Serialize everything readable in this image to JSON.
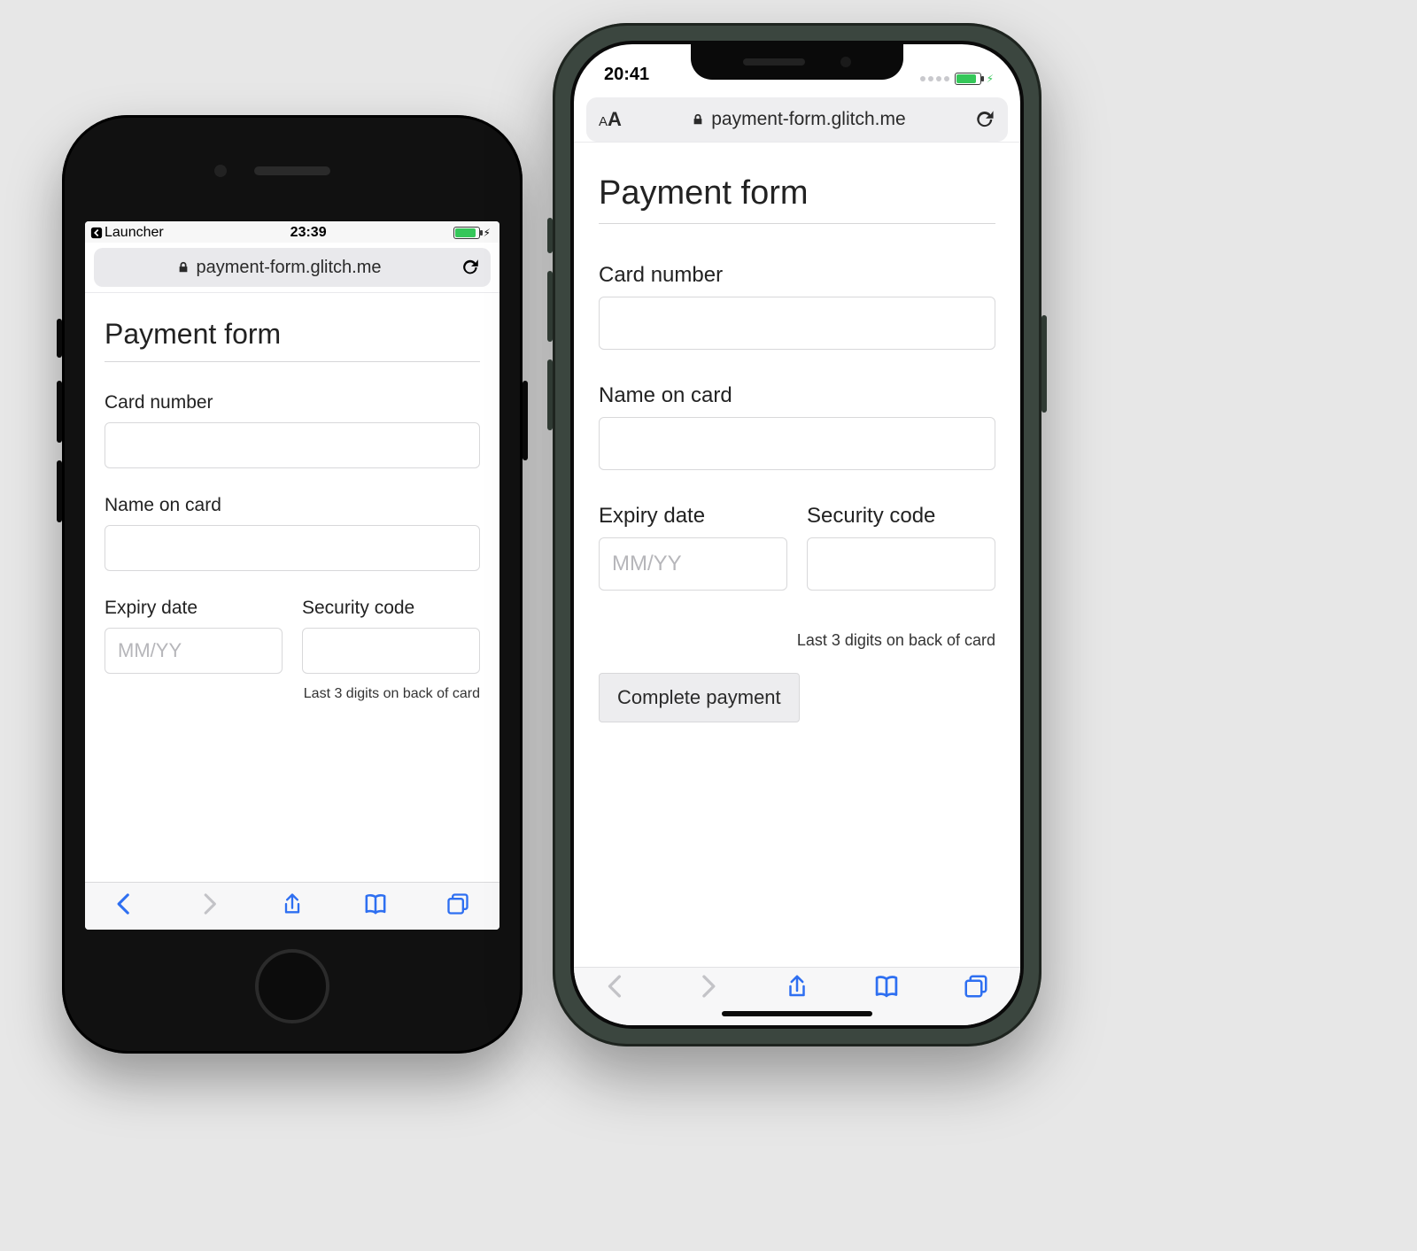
{
  "left": {
    "status": {
      "back_app": "Launcher",
      "time": "23:39"
    },
    "address_bar": {
      "url": "payment-form.glitch.me"
    },
    "page": {
      "title": "Payment form",
      "card_number_label": "Card number",
      "name_label": "Name on card",
      "expiry_label": "Expiry date",
      "expiry_placeholder": "MM/YY",
      "cvc_label": "Security code",
      "cvc_hint": "Last 3 digits on back of card"
    }
  },
  "right": {
    "status": {
      "time": "20:41"
    },
    "address_bar": {
      "aa_small": "A",
      "aa_large": "A",
      "url": "payment-form.glitch.me"
    },
    "page": {
      "title": "Payment form",
      "card_number_label": "Card number",
      "name_label": "Name on card",
      "expiry_label": "Expiry date",
      "expiry_placeholder": "MM/YY",
      "cvc_label": "Security code",
      "cvc_hint": "Last 3 digits on back of card",
      "submit_label": "Complete payment"
    }
  }
}
